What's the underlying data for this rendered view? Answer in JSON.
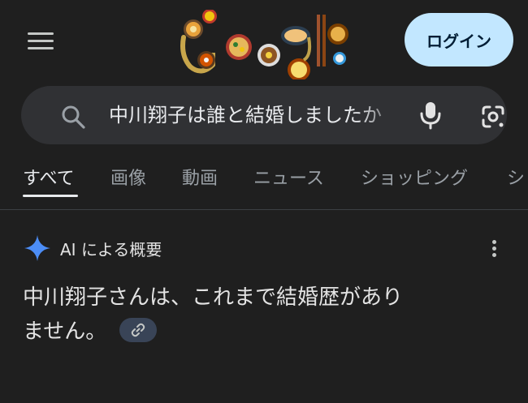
{
  "header": {
    "menu_icon": "hamburger-menu-icon",
    "logo_icon": "google-noodle-doodle-logo",
    "login_label": "ログイン",
    "login_color": "#c2e7ff"
  },
  "search": {
    "query": "中川翔子は誰と結婚しましたか",
    "search_icon": "search-icon",
    "voice_icon": "microphone-icon",
    "lens_icon": "google-lens-icon"
  },
  "tabs": [
    {
      "label": "すべて",
      "active": true
    },
    {
      "label": "画像",
      "active": false
    },
    {
      "label": "動画",
      "active": false
    },
    {
      "label": "ニュース",
      "active": false
    },
    {
      "label": "ショッピング",
      "active": false
    },
    {
      "label": "ショ",
      "active": false
    }
  ],
  "ai_overview": {
    "icon": "gemini-sparkle-icon",
    "title": "AI による概要",
    "more_icon": "more-vert-icon",
    "answer_line1": "中川翔子さんは、これまで結婚歴があり",
    "answer_line2": "ません。",
    "link_icon": "link-icon",
    "accent_color": "#4c8df6"
  }
}
